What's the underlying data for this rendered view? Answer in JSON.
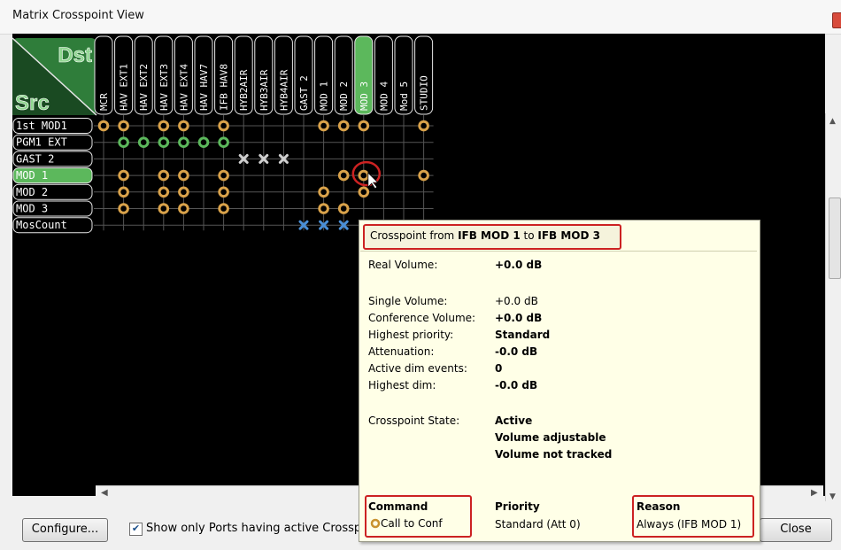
{
  "window": {
    "title": "Matrix Crosspoint View"
  },
  "matrix": {
    "dst_label": "Dst",
    "src_label": "Src",
    "columns": [
      "MCR",
      "HAV EXT1",
      "HAV EXT2",
      "HAV EXT3",
      "HAV EXT4",
      "HAV HAV7",
      "IFB HAV8",
      "HYB2AIR",
      "HYB3AIR",
      "HYB4AIR",
      "GAST 2",
      "MOD 1",
      "MOD 2",
      "MOD 3",
      "MOD 4",
      "Mod 5",
      "STUDIO"
    ],
    "selected_column": 13,
    "rows": [
      "1st MOD1",
      "PGM1 EXT",
      "GAST 2",
      "MOD 1",
      "MOD 2",
      "MOD 3",
      "MosCount"
    ],
    "selected_row": 3,
    "crosspoints": [
      {
        "row": 0,
        "col": 0,
        "type": "orange"
      },
      {
        "row": 0,
        "col": 1,
        "type": "orange"
      },
      {
        "row": 0,
        "col": 3,
        "type": "orange"
      },
      {
        "row": 0,
        "col": 4,
        "type": "orange"
      },
      {
        "row": 0,
        "col": 6,
        "type": "orange"
      },
      {
        "row": 0,
        "col": 11,
        "type": "orange"
      },
      {
        "row": 0,
        "col": 12,
        "type": "orange"
      },
      {
        "row": 0,
        "col": 13,
        "type": "orange"
      },
      {
        "row": 0,
        "col": 16,
        "type": "orange"
      },
      {
        "row": 1,
        "col": 1,
        "type": "green"
      },
      {
        "row": 1,
        "col": 2,
        "type": "green"
      },
      {
        "row": 1,
        "col": 3,
        "type": "green"
      },
      {
        "row": 1,
        "col": 4,
        "type": "green"
      },
      {
        "row": 1,
        "col": 5,
        "type": "green"
      },
      {
        "row": 1,
        "col": 6,
        "type": "green"
      },
      {
        "row": 2,
        "col": 7,
        "type": "grey-x"
      },
      {
        "row": 2,
        "col": 8,
        "type": "grey-x"
      },
      {
        "row": 2,
        "col": 9,
        "type": "grey-x"
      },
      {
        "row": 3,
        "col": 1,
        "type": "orange"
      },
      {
        "row": 3,
        "col": 3,
        "type": "orange"
      },
      {
        "row": 3,
        "col": 4,
        "type": "orange"
      },
      {
        "row": 3,
        "col": 6,
        "type": "orange"
      },
      {
        "row": 3,
        "col": 12,
        "type": "orange"
      },
      {
        "row": 3,
        "col": 13,
        "type": "orange"
      },
      {
        "row": 3,
        "col": 16,
        "type": "orange"
      },
      {
        "row": 4,
        "col": 1,
        "type": "orange"
      },
      {
        "row": 4,
        "col": 3,
        "type": "orange"
      },
      {
        "row": 4,
        "col": 4,
        "type": "orange"
      },
      {
        "row": 4,
        "col": 6,
        "type": "orange"
      },
      {
        "row": 4,
        "col": 11,
        "type": "orange"
      },
      {
        "row": 4,
        "col": 13,
        "type": "orange"
      },
      {
        "row": 5,
        "col": 1,
        "type": "orange"
      },
      {
        "row": 5,
        "col": 3,
        "type": "orange"
      },
      {
        "row": 5,
        "col": 4,
        "type": "orange"
      },
      {
        "row": 5,
        "col": 6,
        "type": "orange"
      },
      {
        "row": 5,
        "col": 11,
        "type": "orange"
      },
      {
        "row": 5,
        "col": 12,
        "type": "orange"
      },
      {
        "row": 6,
        "col": 10,
        "type": "blue-x"
      },
      {
        "row": 6,
        "col": 11,
        "type": "blue-x"
      },
      {
        "row": 6,
        "col": 12,
        "type": "blue-x"
      },
      {
        "row": 6,
        "col": 13,
        "type": "blue-x"
      }
    ]
  },
  "tooltip": {
    "title_prefix": "Crosspoint from ",
    "title_src": "IFB MOD 1",
    "title_mid": " to ",
    "title_dst": "IFB MOD 3",
    "real_volume_label": "Real Volume:",
    "real_volume_value": "+0.0 dB",
    "single_volume_label": "Single Volume:",
    "single_volume_value": "+0.0 dB",
    "conference_volume_label": "Conference Volume:",
    "conference_volume_value": "+0.0 dB",
    "highest_priority_label": "Highest priority:",
    "highest_priority_value": "Standard",
    "attenuation_label": "Attenuation:",
    "attenuation_value": "-0.0 dB",
    "active_dim_label": "Active dim events:",
    "active_dim_value": "0",
    "highest_dim_label": "Highest dim:",
    "highest_dim_value": "-0.0 dB",
    "state_label": "Crosspoint State:",
    "state_values": [
      "Active",
      "Volume adjustable",
      "Volume not tracked"
    ],
    "command_header": "Command",
    "command_value": "Call to Conf",
    "priority_header": "Priority",
    "priority_value": "Standard (Att 0)",
    "reason_header": "Reason",
    "reason_value": "Always  (IFB MOD 1)"
  },
  "footer": {
    "configure_label": "Configure...",
    "show_only_label": "Show only Ports having active Crosspoints",
    "close_label": "Close"
  },
  "colors": {
    "green": "#5cb85c",
    "orange": "#d9a24a",
    "highlight_red": "#cc2222",
    "tooltip_bg": "#ffffe7"
  }
}
